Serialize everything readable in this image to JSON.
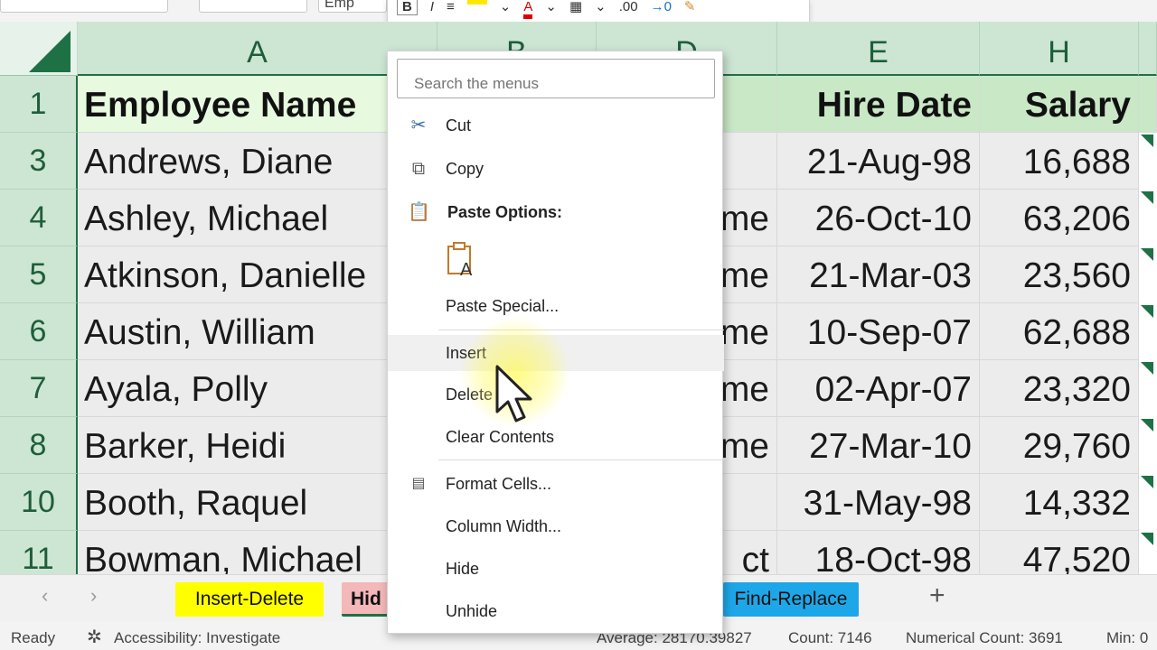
{
  "ribbon": {
    "font_box_text": "Emp",
    "mini_toolbar": [
      "B",
      "I",
      "≡",
      "A",
      ".00",
      "→0"
    ]
  },
  "grid": {
    "columns": [
      "A",
      "B",
      "D",
      "E",
      "H"
    ],
    "rows": [
      {
        "num": "1",
        "name": "Employee Name",
        "dept": "",
        "date": "Hire Date",
        "salary": "Salary",
        "header": true
      },
      {
        "num": "3",
        "name": "Andrews, Diane",
        "dept": "",
        "date": "21-Aug-98",
        "salary": "16,688"
      },
      {
        "num": "4",
        "name": "Ashley, Michael",
        "dept": "me",
        "date": "26-Oct-10",
        "salary": "63,206"
      },
      {
        "num": "5",
        "name": "Atkinson, Danielle",
        "dept": "me",
        "date": "21-Mar-03",
        "salary": "23,560"
      },
      {
        "num": "6",
        "name": "Austin, William",
        "dept": "me",
        "date": "10-Sep-07",
        "salary": "62,688"
      },
      {
        "num": "7",
        "name": "Ayala, Polly",
        "dept": "me",
        "date": "02-Apr-07",
        "salary": "23,320"
      },
      {
        "num": "8",
        "name": "Barker, Heidi",
        "dept": "me",
        "date": "27-Mar-10",
        "salary": "29,760"
      },
      {
        "num": "10",
        "name": "Booth, Raquel",
        "dept": "",
        "date": "31-May-98",
        "salary": "14,332"
      },
      {
        "num": "11",
        "name": "Bowman, Michael",
        "dept": "ct",
        "date": "18-Oct-98",
        "salary": "47,520"
      }
    ]
  },
  "context_menu": {
    "search_placeholder": "Search the menus",
    "cut": "Cut",
    "copy": "Copy",
    "paste_options": "Paste Options:",
    "paste_special": "Paste Special...",
    "insert": "Insert",
    "delete": "Delete",
    "clear_contents": "Clear Contents",
    "format_cells": "Format Cells...",
    "column_width": "Column Width...",
    "hide": "Hide",
    "unhide": "Unhide"
  },
  "sheet_tabs": [
    {
      "label": "Insert-Delete",
      "color": "#ffff00"
    },
    {
      "label": "Hid",
      "color": "#f4b8b8"
    },
    {
      "label": "Find-Replace",
      "color": "#1ea7e8"
    }
  ],
  "status_bar": {
    "ready": "Ready",
    "accessibility": "Accessibility: Investigate",
    "average": "Average: 28170.39827",
    "count": "Count: 7146",
    "numerical_count": "Numerical Count: 3691",
    "min": "Min: 0"
  },
  "colors": {
    "excel_green": "#1e7145",
    "header_fill": "#c9e8c6",
    "highlight_yellow": "#fffa50"
  }
}
